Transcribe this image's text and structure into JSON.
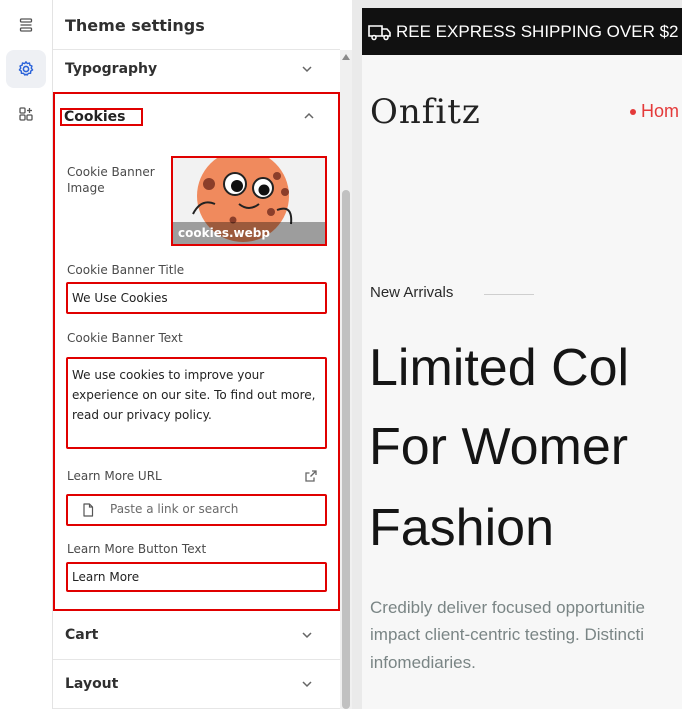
{
  "rail": {
    "items": [
      {
        "icon": "sections-icon"
      },
      {
        "icon": "gear-icon"
      },
      {
        "icon": "add-block-icon"
      }
    ]
  },
  "panel": {
    "title": "Theme settings",
    "sections": {
      "typography": "Typography",
      "cookies": "Cookies",
      "cart": "Cart",
      "layout": "Layout"
    },
    "cookies": {
      "image_label": "Cookie Banner Image",
      "image_filename": "cookies.webp",
      "title_label": "Cookie Banner Title",
      "title_value": "We Use Cookies",
      "text_label": "Cookie Banner Text",
      "text_value": "We use cookies to improve your experience on our site. To find out more, read our privacy policy.",
      "url_label": "Learn More URL",
      "url_placeholder": "Paste a link or search",
      "button_label": "Learn More Button Text",
      "button_value": "Learn More"
    }
  },
  "preview": {
    "announcement": "REE EXPRESS SHIPPING OVER $2",
    "logo": "Onfitz",
    "nav_home": "Hom",
    "kicker": "New Arrivals",
    "hero": [
      "Limited Col",
      "For Womer",
      "Fashion"
    ],
    "description": [
      "Credibly deliver focused opportunitie",
      "impact client-centric testing. Distincti",
      "infomediaries."
    ]
  },
  "colors": {
    "highlight": "#e00000",
    "accent": "#e43a3a",
    "announcement_bg": "#111111"
  }
}
